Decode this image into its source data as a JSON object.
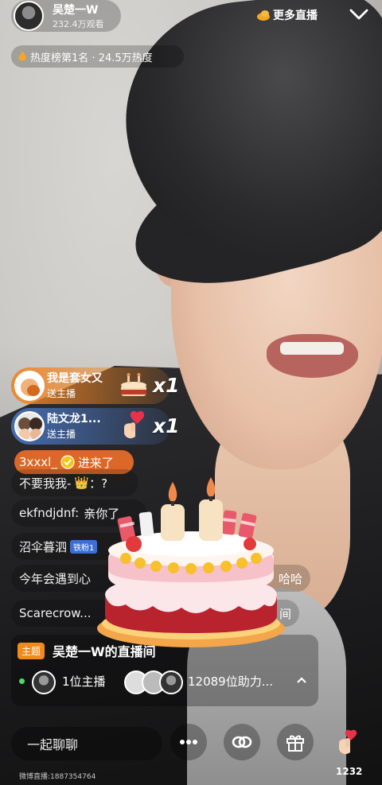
{
  "header": {
    "host_name": "吴楚一W",
    "viewers": "232.4万观看",
    "more_live": "更多直播",
    "rank": "热度榜第1名 · 24.5万热度"
  },
  "gifts": [
    {
      "user": "我是套女又",
      "action": "送主播",
      "count": "x1",
      "gift_icon": "cake-icon"
    },
    {
      "user": "陆文龙1...",
      "action": "送主播",
      "count": "x1",
      "gift_icon": "finger-heart-icon"
    }
  ],
  "enter_notice": {
    "user": "3xxxl_",
    "text": "进来了"
  },
  "chat": [
    {
      "user": "不要我我-",
      "message": "：?"
    },
    {
      "user": "ekfndjdnf:",
      "message": "亲你了"
    },
    {
      "user": "沼伞暮泗",
      "badge": "铁粉1",
      "message": ""
    },
    {
      "user": "今年会遇到心",
      "message": "哈哈"
    },
    {
      "user": "Scarecrow...",
      "message": "间"
    }
  ],
  "topic": {
    "tag": "主题",
    "title": "吴楚一W的直播间",
    "host_count": "1位主播",
    "booster_count": "12089位助力..."
  },
  "bottom": {
    "chat_placeholder": "一起聊聊",
    "like_count": "1232",
    "watermark": "微博直播:1887354764"
  },
  "icons": [
    "cloud-icon",
    "chevron-down-icon",
    "flame-icon",
    "more-icon",
    "link-icon",
    "gift-icon",
    "finger-heart-icon"
  ]
}
